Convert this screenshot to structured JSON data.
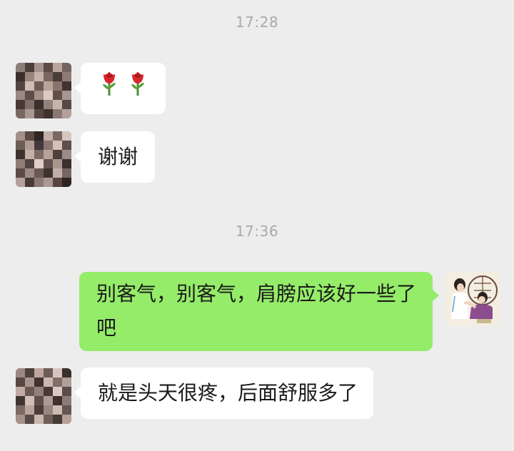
{
  "chat": {
    "timestamps": [
      "17:28",
      "17:36"
    ],
    "messages": [
      {
        "side": "received",
        "kind": "emoji",
        "icons": [
          "rose-icon",
          "rose-icon"
        ]
      },
      {
        "side": "received",
        "kind": "text",
        "text": "谢谢"
      },
      {
        "side": "sent",
        "kind": "text",
        "text": "别客气，别客气，肩膀应该好一些了吧"
      },
      {
        "side": "received",
        "kind": "text",
        "text": "就是头天很疼，后面舒服多了"
      }
    ]
  },
  "colors": {
    "background": "#ededed",
    "received_bubble": "#ffffff",
    "sent_bubble": "#95ec69",
    "timestamp_text": "#a9a9a9"
  }
}
